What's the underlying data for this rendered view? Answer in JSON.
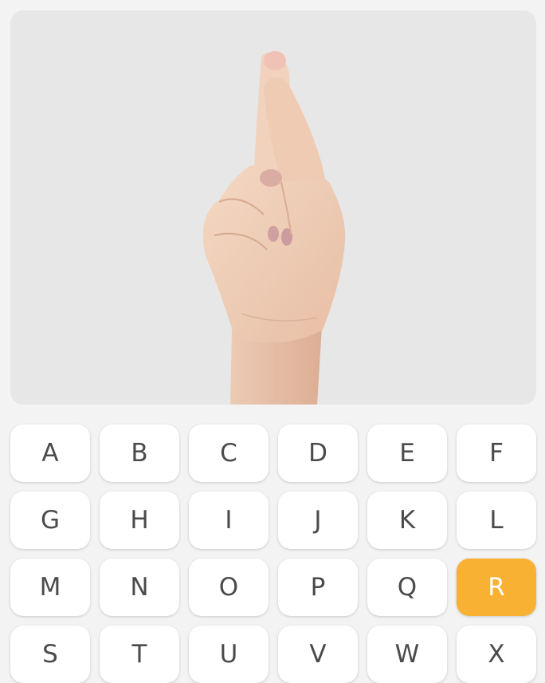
{
  "media": {
    "image_name": "hand-sign-r",
    "background": "#e8e7e7"
  },
  "keyboard": {
    "selected": "R",
    "accent": "#f8b133",
    "keys": [
      "A",
      "B",
      "C",
      "D",
      "E",
      "F",
      "G",
      "H",
      "I",
      "J",
      "K",
      "L",
      "M",
      "N",
      "O",
      "P",
      "Q",
      "R",
      "S",
      "T",
      "U",
      "V",
      "W",
      "X"
    ]
  }
}
